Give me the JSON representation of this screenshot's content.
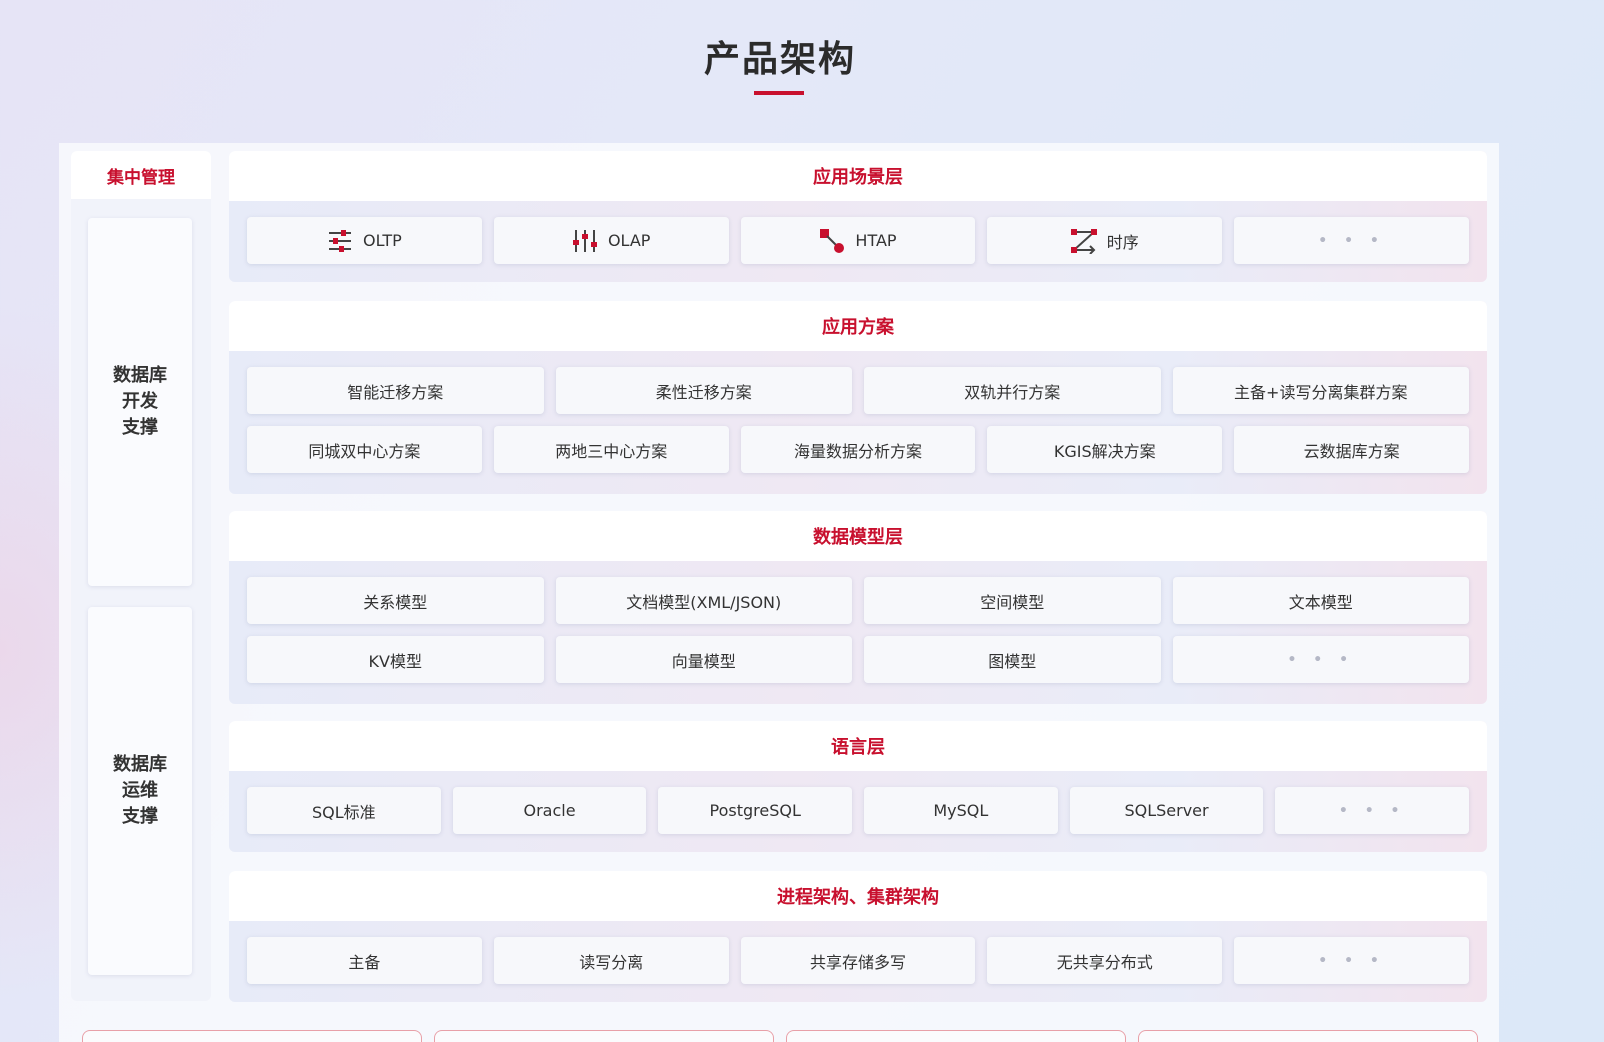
{
  "page": {
    "title": "产品架构"
  },
  "sidebar": {
    "title": "集中管理",
    "boxes": [
      {
        "lines": [
          "数据库",
          "开发",
          "支撑"
        ]
      },
      {
        "lines": [
          "数据库",
          "运维",
          "支撑"
        ]
      }
    ]
  },
  "layers": {
    "scenario": {
      "title": "应用场景层",
      "items": [
        {
          "label": "OLTP",
          "icon": "sliders-icon"
        },
        {
          "label": "OLAP",
          "icon": "vertical-sliders-icon"
        },
        {
          "label": "HTAP",
          "icon": "node-link-icon"
        },
        {
          "label": "时序",
          "icon": "swap-arrows-icon"
        },
        {
          "label": "• • •",
          "icon": "more-icon"
        }
      ]
    },
    "solutions": {
      "title": "应用方案",
      "row1": [
        "智能迁移方案",
        "柔性迁移方案",
        "双轨并行方案",
        "主备+读写分离集群方案"
      ],
      "row2": [
        "同城双中心方案",
        "两地三中心方案",
        "海量数据分析方案",
        "KGIS解决方案",
        "云数据库方案"
      ]
    },
    "models": {
      "title": "数据模型层",
      "row1": [
        "关系模型",
        "文档模型(XML/JSON)",
        "空间模型",
        "文本模型"
      ],
      "row2": [
        "KV模型",
        "向量模型",
        "图模型",
        "• • •"
      ]
    },
    "language": {
      "title": "语言层",
      "items": [
        "SQL标准",
        "Oracle",
        "PostgreSQL",
        "MySQL",
        "SQLServer",
        "• • •"
      ]
    },
    "architecture": {
      "title": "进程架构、集群架构",
      "items": [
        "主备",
        "读写分离",
        "共享存储多写",
        "无共享分布式",
        "• • •"
      ]
    }
  },
  "colors": {
    "accent": "#c8102e",
    "text": "#333333",
    "panel": "#f1f3fa"
  }
}
